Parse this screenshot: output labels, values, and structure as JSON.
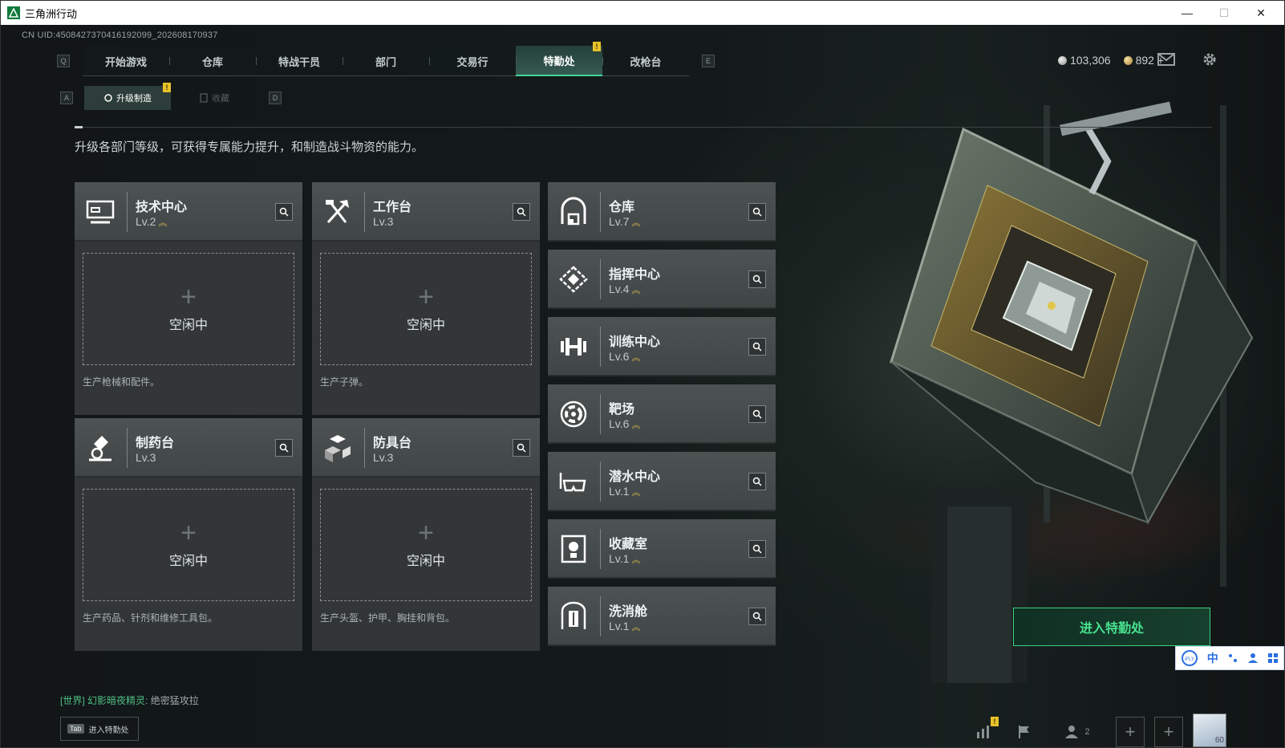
{
  "window": {
    "title": "三角洲行动",
    "controls": {
      "minimize": "—",
      "maximize": "☐",
      "close": "✕"
    }
  },
  "uid": "CN UID:4508427370416192099_202608170937",
  "nav": {
    "left_key": "Q",
    "right_key": "E",
    "tabs": [
      {
        "label": "开始游戏"
      },
      {
        "label": "仓库"
      },
      {
        "label": "特战干员"
      },
      {
        "label": "部门"
      },
      {
        "label": "交易行"
      },
      {
        "label": "特勤处",
        "active": true,
        "badge": "!"
      },
      {
        "label": "改枪台"
      }
    ]
  },
  "currency": {
    "silver": "103,306",
    "gold": "892",
    "add": "+"
  },
  "subnav": {
    "left_key": "A",
    "right_key": "D",
    "tabs": [
      {
        "label": "升级制造",
        "active": true,
        "badge": "!"
      },
      {
        "label": "收藏"
      }
    ]
  },
  "description": "升级各部门等级，可获得专属能力提升，和制造战斗物资的能力。",
  "production": [
    {
      "name": "技术中心",
      "level": "Lv.2",
      "icon": "computer-icon",
      "slot": "空闲中",
      "note": "生产枪械和配件。"
    },
    {
      "name": "工作台",
      "level": "Lv.3",
      "icon": "tools-icon",
      "slot": "空闲中",
      "note": "生产子弹。"
    },
    {
      "name": "制药台",
      "level": "Lv.3",
      "icon": "microscope-icon",
      "slot": "空闲中",
      "note": "生产药品、针剂和维修工具包。"
    },
    {
      "name": "防具台",
      "level": "Lv.3",
      "icon": "cubes-icon",
      "slot": "空闲中",
      "note": "生产头盔、护甲、胸挂和背包。"
    }
  ],
  "facilities": [
    {
      "name": "仓库",
      "level": "Lv.7",
      "icon": "warehouse-icon"
    },
    {
      "name": "指挥中心",
      "level": "Lv.4",
      "icon": "command-icon"
    },
    {
      "name": "训练中心",
      "level": "Lv.6",
      "icon": "dumbbell-icon"
    },
    {
      "name": "靶场",
      "level": "Lv.6",
      "icon": "target-icon"
    },
    {
      "name": "潜水中心",
      "level": "Lv.1",
      "icon": "diving-mask-icon"
    },
    {
      "name": "收藏室",
      "level": "Lv.1",
      "icon": "trophy-icon"
    },
    {
      "name": "洗消舱",
      "level": "Lv.1",
      "icon": "decon-icon"
    }
  ],
  "level_up_glyph": "︽",
  "enter_button": "进入特勤处",
  "ime": {
    "label": "中",
    "logo": "iFLY"
  },
  "chat": {
    "channel": "[世界]",
    "sender": "幻影暗夜精灵:",
    "message": "绝密猛攻拉"
  },
  "tab_hint": {
    "key": "Tab",
    "label": "进入特勤处"
  },
  "squad_count": "2",
  "avatar_level": "60",
  "colors": {
    "accent": "#3ed49a",
    "upgrade": "#d6b74f",
    "badge": "#e8c229"
  }
}
